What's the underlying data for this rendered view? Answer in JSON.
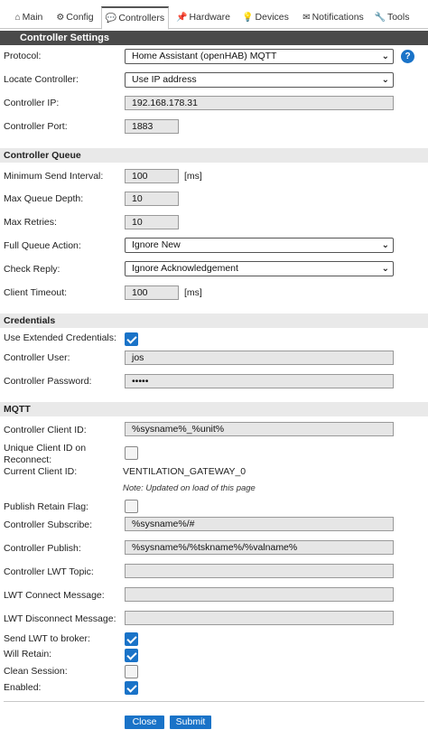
{
  "tabs": [
    {
      "icon": "⌂",
      "label": "Main"
    },
    {
      "icon": "⚙",
      "label": "Config"
    },
    {
      "icon": "💬",
      "label": "Controllers"
    },
    {
      "icon": "📌",
      "label": "Hardware"
    },
    {
      "icon": "💡",
      "label": "Devices"
    },
    {
      "icon": "✉",
      "label": "Notifications"
    },
    {
      "icon": "🔧",
      "label": "Tools"
    }
  ],
  "title": "Controller Settings",
  "basic": {
    "protocol_label": "Protocol:",
    "protocol_value": "Home Assistant (openHAB) MQTT",
    "help": "?",
    "locate_label": "Locate Controller:",
    "locate_value": "Use IP address",
    "ip_label": "Controller IP:",
    "ip_value": "192.168.178.31",
    "port_label": "Controller Port:",
    "port_value": "1883"
  },
  "queue": {
    "header": "Controller Queue",
    "min_send_label": "Minimum Send Interval:",
    "min_send_value": "100",
    "min_send_unit": "[ms]",
    "max_depth_label": "Max Queue Depth:",
    "max_depth_value": "10",
    "max_retries_label": "Max Retries:",
    "max_retries_value": "10",
    "full_action_label": "Full Queue Action:",
    "full_action_value": "Ignore New",
    "check_reply_label": "Check Reply:",
    "check_reply_value": "Ignore Acknowledgement",
    "timeout_label": "Client Timeout:",
    "timeout_value": "100",
    "timeout_unit": "[ms]"
  },
  "credentials": {
    "header": "Credentials",
    "extended_label": "Use Extended Credentials:",
    "extended_checked": true,
    "user_label": "Controller User:",
    "user_value": "jos",
    "password_label": "Controller Password:",
    "password_value": "•••••"
  },
  "mqtt": {
    "header": "MQTT",
    "client_id_label": "Controller Client ID:",
    "client_id_value": "%sysname%_%unit%",
    "unique_label_1": "Unique Client ID on",
    "unique_label_2": "Reconnect:",
    "unique_checked": false,
    "current_id_label": "Current Client ID:",
    "current_id_value": "VENTILATION_GATEWAY_0",
    "note": "Note: Updated on load of this page",
    "retain_flag_label": "Publish Retain Flag:",
    "retain_flag_checked": false,
    "subscribe_label": "Controller Subscribe:",
    "subscribe_value": "%sysname%/#",
    "publish_label": "Controller Publish:",
    "publish_value": "%sysname%/%tskname%/%valname%",
    "lwt_topic_label": "Controller LWT Topic:",
    "lwt_topic_value": "",
    "lwt_connect_label": "LWT Connect Message:",
    "lwt_connect_value": "",
    "lwt_disconnect_label": "LWT Disconnect Message:",
    "lwt_disconnect_value": "",
    "send_lwt_label": "Send LWT to broker:",
    "send_lwt_checked": true,
    "will_retain_label": "Will Retain:",
    "will_retain_checked": true,
    "clean_session_label": "Clean Session:",
    "clean_session_checked": false,
    "enabled_label": "Enabled:",
    "enabled_checked": true
  },
  "buttons": {
    "close": "Close",
    "submit": "Submit"
  },
  "colors": {
    "accent": "#1a73c8",
    "section_header_bg": "#4a4a4a",
    "group_header_bg": "#e9e9e9"
  }
}
